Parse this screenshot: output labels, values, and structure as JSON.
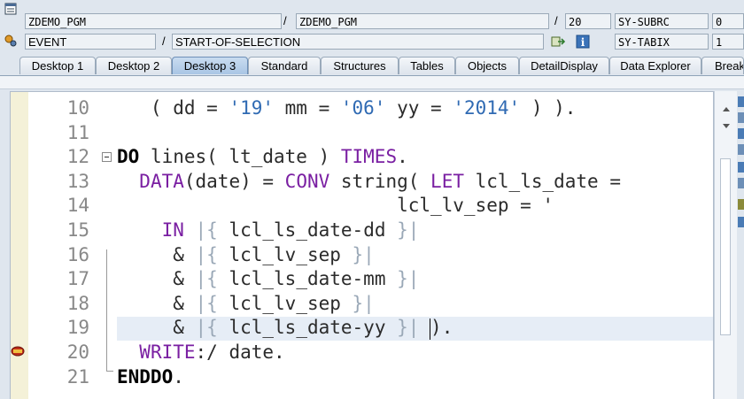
{
  "header": {
    "row1": {
      "program1": "ZDEMO_PGM",
      "sep1": "/",
      "program2": "ZDEMO_PGM",
      "sep2": "/",
      "line": "20",
      "sysvar": "SY-SUBRC",
      "sysval": "0"
    },
    "row2": {
      "event_label": "EVENT",
      "sep": "/",
      "event_value": "START-OF-SELECTION",
      "sysvar": "SY-TABIX",
      "sysval": "1"
    }
  },
  "tabs": [
    {
      "label": "Desktop 1",
      "active": false
    },
    {
      "label": "Desktop 2",
      "active": false
    },
    {
      "label": "Desktop 3",
      "active": true
    },
    {
      "label": "Standard",
      "active": false
    },
    {
      "label": "Structures",
      "active": false
    },
    {
      "label": "Tables",
      "active": false
    },
    {
      "label": "Objects",
      "active": false
    },
    {
      "label": "DetailDisplay",
      "active": false
    },
    {
      "label": "Data Explorer",
      "active": false
    },
    {
      "label": "Break",
      "active": false
    }
  ],
  "code_lines": [
    {
      "num": "10",
      "segments": [
        {
          "t": "   ( dd = ",
          "c": ""
        },
        {
          "t": "'19'",
          "c": "str"
        },
        {
          "t": " mm = ",
          "c": ""
        },
        {
          "t": "'06'",
          "c": "str"
        },
        {
          "t": " yy = ",
          "c": ""
        },
        {
          "t": "'2014'",
          "c": "str"
        },
        {
          "t": " ) ).",
          "c": ""
        }
      ]
    },
    {
      "num": "11",
      "segments": []
    },
    {
      "num": "12",
      "segments": [
        {
          "t": "DO",
          "c": "bkw"
        },
        {
          "t": " lines( lt_date ) ",
          "c": ""
        },
        {
          "t": "TIMES",
          "c": "kw"
        },
        {
          "t": ".",
          "c": ""
        }
      ]
    },
    {
      "num": "13",
      "segments": [
        {
          "t": "  ",
          "c": ""
        },
        {
          "t": "DATA",
          "c": "kw"
        },
        {
          "t": "(date) = ",
          "c": ""
        },
        {
          "t": "CONV",
          "c": "kw"
        },
        {
          "t": " string( ",
          "c": ""
        },
        {
          "t": "LET",
          "c": "kw"
        },
        {
          "t": " lcl_ls_date =",
          "c": ""
        }
      ]
    },
    {
      "num": "14",
      "segments": [
        {
          "t": "                         lcl_lv_sep = '",
          "c": ""
        }
      ]
    },
    {
      "num": "15",
      "segments": [
        {
          "t": "    ",
          "c": ""
        },
        {
          "t": "IN",
          "c": "kw"
        },
        {
          "t": " ",
          "c": ""
        },
        {
          "t": "|{",
          "c": "bar"
        },
        {
          "t": " lcl_ls_date-dd ",
          "c": ""
        },
        {
          "t": "}|",
          "c": "bar"
        }
      ]
    },
    {
      "num": "16",
      "segments": [
        {
          "t": "     & ",
          "c": ""
        },
        {
          "t": "|{",
          "c": "bar"
        },
        {
          "t": " lcl_lv_sep ",
          "c": ""
        },
        {
          "t": "}|",
          "c": "bar"
        }
      ]
    },
    {
      "num": "17",
      "segments": [
        {
          "t": "     & ",
          "c": ""
        },
        {
          "t": "|{",
          "c": "bar"
        },
        {
          "t": " lcl_ls_date-mm ",
          "c": ""
        },
        {
          "t": "}|",
          "c": "bar"
        }
      ]
    },
    {
      "num": "18",
      "segments": [
        {
          "t": "     & ",
          "c": ""
        },
        {
          "t": "|{",
          "c": "bar"
        },
        {
          "t": " lcl_lv_sep ",
          "c": ""
        },
        {
          "t": "}|",
          "c": "bar"
        }
      ]
    },
    {
      "num": "19",
      "segments": [
        {
          "t": "     & ",
          "c": ""
        },
        {
          "t": "|{",
          "c": "bar"
        },
        {
          "t": " lcl_ls_date-yy ",
          "c": ""
        },
        {
          "t": "}|",
          "c": "bar"
        },
        {
          "t": " ).",
          "c": ""
        }
      ]
    },
    {
      "num": "20",
      "segments": [
        {
          "t": "  ",
          "c": ""
        },
        {
          "t": "WRITE",
          "c": "kw"
        },
        {
          "t": ":/ date.",
          "c": ""
        }
      ]
    },
    {
      "num": "21",
      "segments": [
        {
          "t": "ENDDO",
          "c": "bkw"
        },
        {
          "t": ".",
          "c": ""
        }
      ]
    }
  ],
  "editor": {
    "current_line": "19",
    "breakpoint_line": "20"
  }
}
